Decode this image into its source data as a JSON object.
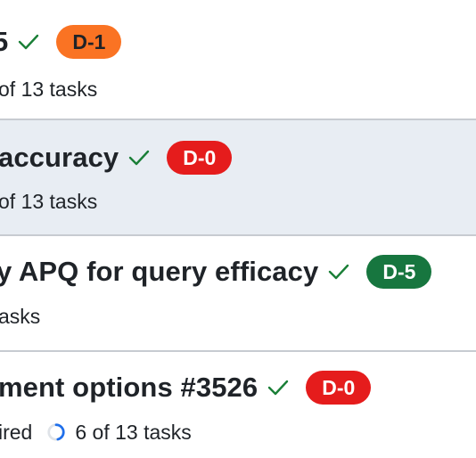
{
  "rows": [
    {
      "title": "5",
      "badge": "D-1",
      "badge_color": "#fa7323",
      "meta": "of 13 tasks"
    },
    {
      "title": "accuracy",
      "badge": "D-0",
      "badge_color": "#e51c1c",
      "meta": "of 13 tasks"
    },
    {
      "title": "y APQ for query efficacy",
      "badge": "D-5",
      "badge_color": "#17763f",
      "meta": "asks"
    },
    {
      "title": "ment options #3526",
      "badge": "D-0",
      "badge_color": "#e51c1c",
      "meta_prefix": "ired",
      "meta": "6 of 13 tasks",
      "progress_fraction": 0.46
    }
  ],
  "icons": {
    "check": "check-icon",
    "progress": "progress-ring-icon"
  },
  "colors": {
    "check": "#1a7f37",
    "selected_row_bg": "#e8edf3",
    "divider": "#c7cbd1"
  }
}
